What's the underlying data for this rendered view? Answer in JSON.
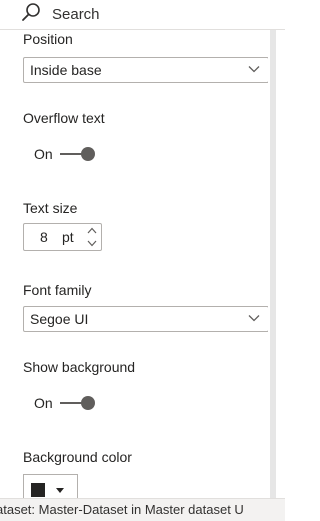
{
  "search": {
    "label": "Search"
  },
  "position": {
    "label": "Position",
    "value": "Inside base"
  },
  "overflow_text": {
    "label": "Overflow text",
    "state": "On"
  },
  "text_size": {
    "label": "Text size",
    "value": "8",
    "unit": "pt"
  },
  "font_family": {
    "label": "Font family",
    "value": "Segoe UI"
  },
  "show_background": {
    "label": "Show background",
    "state": "On"
  },
  "background_color": {
    "label": "Background color",
    "color": "#252423"
  },
  "status_bar": {
    "text": "ataset: Master-Dataset in Master dataset  U"
  }
}
